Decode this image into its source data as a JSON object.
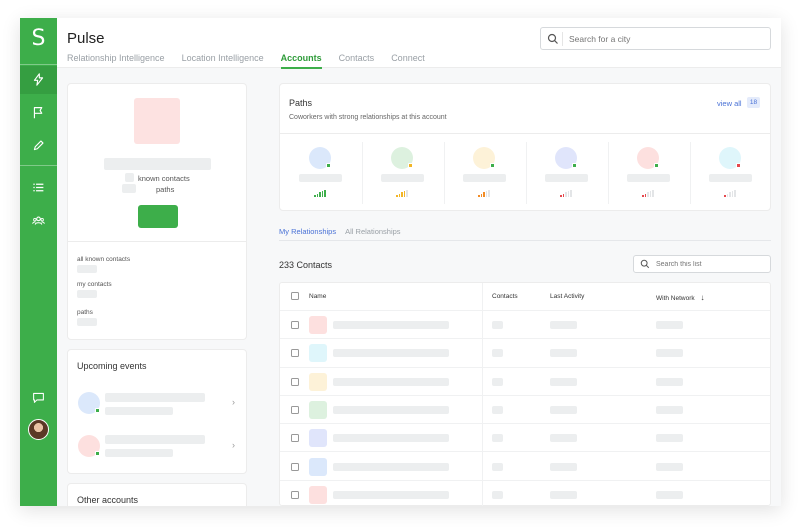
{
  "app": {
    "title": "Pulse"
  },
  "nav_tabs": [
    {
      "label": "Relationship Intelligence"
    },
    {
      "label": "Location Intelligence"
    },
    {
      "label": "Accounts"
    },
    {
      "label": "Contacts"
    },
    {
      "label": "Connect"
    }
  ],
  "active_tab": "Accounts",
  "search": {
    "placeholder": "Search for a city"
  },
  "account": {
    "known_contacts_label": "known contacts",
    "paths_label": "paths",
    "stats": [
      {
        "label": "all known contacts"
      },
      {
        "label": "my contacts"
      },
      {
        "label": "paths"
      }
    ]
  },
  "upcoming_events": {
    "title": "Upcoming events"
  },
  "other_accounts": {
    "title": "Other accounts"
  },
  "paths": {
    "title": "Paths",
    "subtitle": "Coworkers with strong relationships at this account",
    "view_all_label": "view all",
    "count": "18",
    "people": [
      {
        "avatar_color": "#dbe8fb",
        "badge_color": "#3dae4a",
        "signal_color": "#3dae4a",
        "signal_level": 5
      },
      {
        "avatar_color": "#ddf1df",
        "badge_color": "#f2b526",
        "signal_color": "#f2b526",
        "signal_level": 4
      },
      {
        "avatar_color": "#fdf2d8",
        "badge_color": "#3dae4a",
        "signal_color": "#f28c26",
        "signal_level": 3
      },
      {
        "avatar_color": "#e0e5fb",
        "badge_color": "#3dae4a",
        "signal_color": "#e5484d",
        "signal_level": 2
      },
      {
        "avatar_color": "#fde0df",
        "badge_color": "#3dae4a",
        "signal_color": "#e5484d",
        "signal_level": 2
      },
      {
        "avatar_color": "#dff6fb",
        "badge_color": "#e5484d",
        "signal_color": "#e5484d",
        "signal_level": 1
      }
    ]
  },
  "relationships": {
    "tabs": [
      {
        "label": "My Relationships"
      },
      {
        "label": "All Relationships"
      }
    ],
    "count_label": "233 Contacts",
    "search_placeholder": "Search this list",
    "columns": {
      "name": "Name",
      "contacts": "Contacts",
      "last_activity": "Last Activity",
      "with_network": "With Network"
    },
    "rows": [
      {
        "avatar_color": "#fde0df"
      },
      {
        "avatar_color": "#dff6fb"
      },
      {
        "avatar_color": "#fdf2d8"
      },
      {
        "avatar_color": "#ddf1df"
      },
      {
        "avatar_color": "#e0e5fb"
      },
      {
        "avatar_color": "#dbe8fb"
      },
      {
        "avatar_color": "#fde0df"
      }
    ]
  },
  "colors": {
    "brand": "#3dae4a",
    "accent_blue": "#4a72d6"
  }
}
